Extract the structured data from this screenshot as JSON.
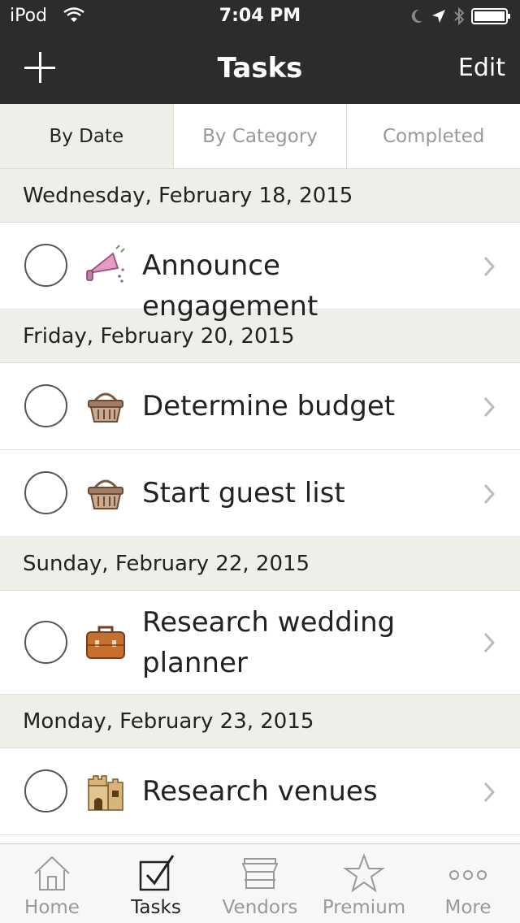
{
  "status_bar": {
    "carrier": "iPod",
    "time": "7:04 PM"
  },
  "nav": {
    "title": "Tasks",
    "edit_label": "Edit"
  },
  "segments": [
    {
      "label": "By Date",
      "active": true
    },
    {
      "label": "By Category",
      "active": false
    },
    {
      "label": "Completed",
      "active": false
    }
  ],
  "sections": [
    {
      "date": "Wednesday, February 18, 2015",
      "tasks": [
        {
          "title": "Announce engagement",
          "icon": "megaphone-icon"
        }
      ]
    },
    {
      "date": "Friday, February 20, 2015",
      "tasks": [
        {
          "title": "Determine budget",
          "icon": "basket-icon"
        },
        {
          "title": "Start guest list",
          "icon": "basket-icon"
        }
      ]
    },
    {
      "date": "Sunday, February 22, 2015",
      "tasks": [
        {
          "title": "Research wedding planner",
          "icon": "briefcase-icon"
        }
      ]
    },
    {
      "date": "Monday, February 23, 2015",
      "tasks": [
        {
          "title": "Research venues",
          "icon": "castle-icon"
        }
      ]
    }
  ],
  "tabs": [
    {
      "label": "Home",
      "icon": "home-icon",
      "active": false
    },
    {
      "label": "Tasks",
      "icon": "checkbox-icon",
      "active": true
    },
    {
      "label": "Vendors",
      "icon": "storefront-icon",
      "active": false
    },
    {
      "label": "Premium",
      "icon": "star-icon",
      "active": false
    },
    {
      "label": "More",
      "icon": "more-dots-icon",
      "active": false
    }
  ],
  "colors": {
    "bar_background": "#2c2c2c",
    "section_background": "#efefea",
    "inactive_tab": "#999999",
    "active_tab": "#222222"
  }
}
